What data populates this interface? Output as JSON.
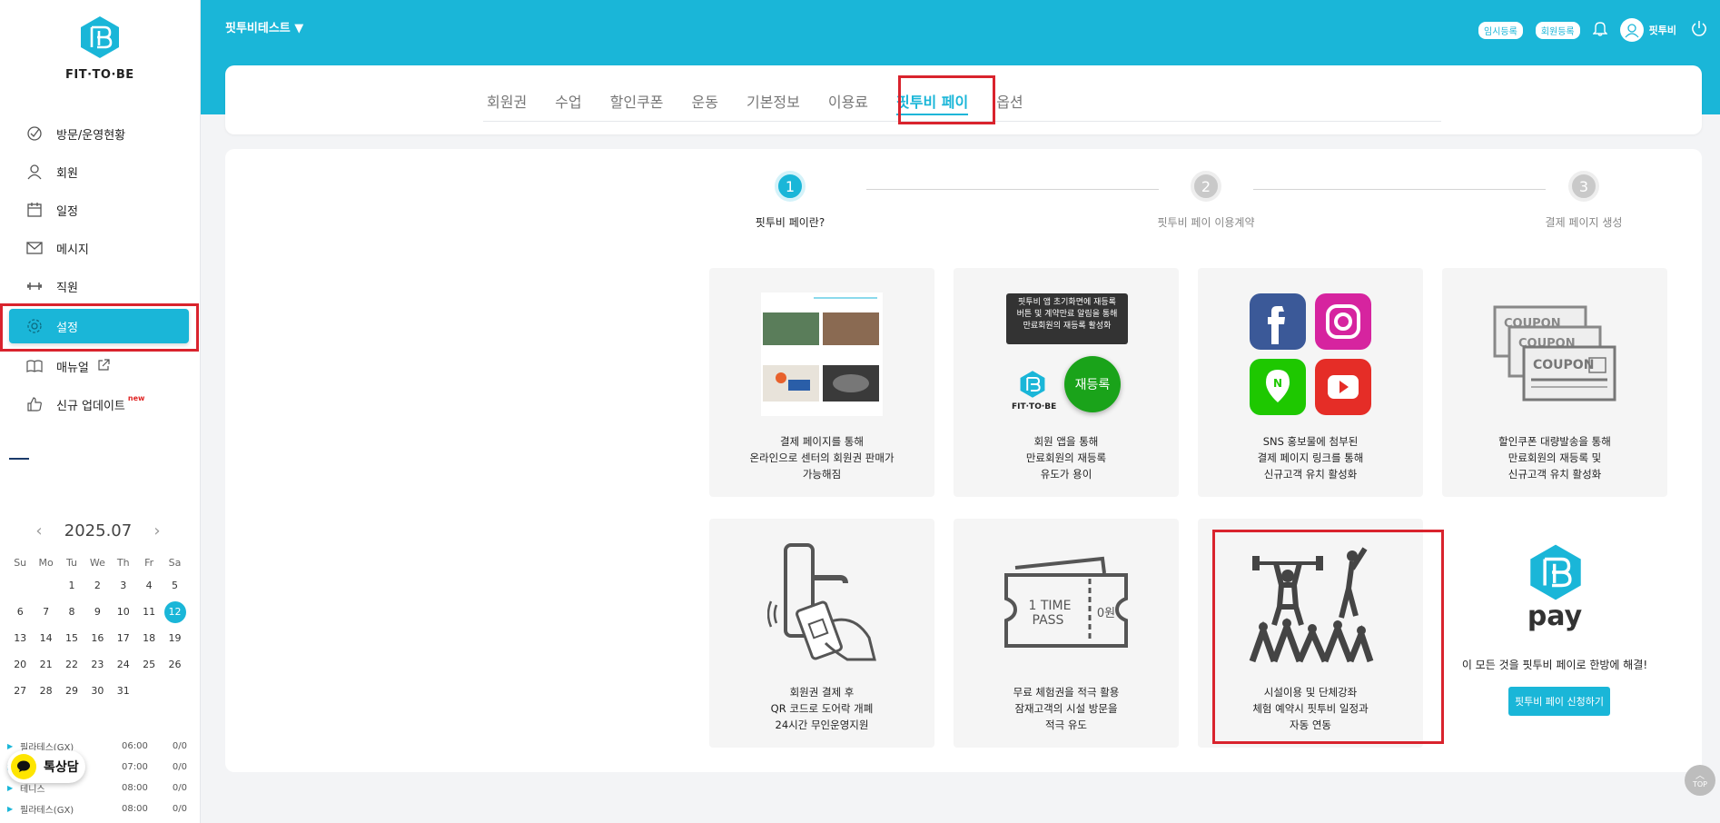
{
  "brand": {
    "name": "FIT·TO·BE",
    "color": "#1ab6d8"
  },
  "sidebar": {
    "items": [
      {
        "label": "방문/운영현황",
        "icon": "visit-status-icon"
      },
      {
        "label": "회원",
        "icon": "user-icon"
      },
      {
        "label": "일정",
        "icon": "calendar-icon"
      },
      {
        "label": "메시지",
        "icon": "mail-icon"
      },
      {
        "label": "직원",
        "icon": "dumbbell-icon"
      },
      {
        "label": "설정",
        "icon": "gear-icon",
        "active": true
      },
      {
        "label": "매뉴얼",
        "icon": "book-icon"
      },
      {
        "label": "신규 업데이트",
        "icon": "thumbs-up-icon",
        "badge": "new"
      }
    ]
  },
  "calendar": {
    "month_label": "2025.07",
    "dow": [
      "Su",
      "Mo",
      "Tu",
      "We",
      "Th",
      "Fr",
      "Sa"
    ],
    "days": [
      "",
      "",
      "1",
      "2",
      "3",
      "4",
      "5",
      "6",
      "7",
      "8",
      "9",
      "10",
      "11",
      "12",
      "13",
      "14",
      "15",
      "16",
      "17",
      "18",
      "19",
      "20",
      "21",
      "22",
      "23",
      "24",
      "25",
      "26",
      "27",
      "28",
      "29",
      "30",
      "31"
    ],
    "today": "12"
  },
  "schedule": [
    {
      "name": "필라테스(GX)",
      "time": "06:00",
      "count": "0/0"
    },
    {
      "name": "",
      "time": "07:00",
      "count": "0/0"
    },
    {
      "name": "테니스",
      "time": "08:00",
      "count": "0/0"
    },
    {
      "name": "필라테스(GX)",
      "time": "08:00",
      "count": "0/0"
    }
  ],
  "kakao": {
    "label": "톡상담"
  },
  "topbar": {
    "center_name": "핏투비테스트 ▼",
    "temp_register": "임시등록",
    "member_register": "회원등록",
    "username": "핏투비"
  },
  "tabs": [
    {
      "label": "회원권"
    },
    {
      "label": "수업"
    },
    {
      "label": "할인쿠폰"
    },
    {
      "label": "운동"
    },
    {
      "label": "기본정보"
    },
    {
      "label": "이용료"
    },
    {
      "label": "핏투비 페이",
      "active": true
    },
    {
      "label": "옵션"
    }
  ],
  "steps": [
    {
      "num": "1",
      "label": "핏투비 페이란?"
    },
    {
      "num": "2",
      "label": "핏투비 페이 이용계약"
    },
    {
      "num": "3",
      "label": "결제 페이지 생성"
    }
  ],
  "cards": [
    {
      "lines": [
        "결제 페이지를 통해",
        "온라인으로 센터의 회원권 판매가",
        "가능해짐"
      ],
      "illus": "app-screens"
    },
    {
      "lines": [
        "회원 앱을 통해",
        "만료회원의 재등록",
        "유도가 용이"
      ],
      "illus": "reregister",
      "tooltip": [
        "핏투비 앱 초기화면에 재등록",
        "버튼 및 계약만료 알림을 통해",
        "만료회원의 재등록 활성화"
      ],
      "button": "재등록"
    },
    {
      "lines": [
        "SNS 홍보물에 첨부된",
        "결제 페이지 링크를 통해",
        "신규고객 유치 활성화"
      ],
      "illus": "sns"
    },
    {
      "lines": [
        "할인쿠폰 대량발송을 통해",
        "만료회원의 재등록 및",
        "신규고객 유치 활성화"
      ],
      "illus": "coupons",
      "coupon_text": "COUPON"
    },
    {
      "lines": [
        "회원권 결제 후",
        "QR 코드로 도어락 개폐",
        "24시간 무인운영지원"
      ],
      "illus": "doorlock"
    },
    {
      "lines": [
        "무료 체험권을 적극 활용",
        "잠재고객의 시설 방문을",
        "적극 유도"
      ],
      "illus": "ticket",
      "ticket_text": [
        "1 TIME",
        "PASS"
      ],
      "ticket_price": "0원"
    },
    {
      "lines": [
        "시설이용 및 단체강좌",
        "체험 예약시 핏투비 일정과",
        "자동 연동"
      ],
      "illus": "fitness"
    }
  ],
  "pay_card": {
    "logo_text": "pay",
    "text": "이 모든 것을 핏투비 페이로 한방에 해결!",
    "button": "핏투비 페이 신청하기"
  },
  "top_button": "TOP"
}
